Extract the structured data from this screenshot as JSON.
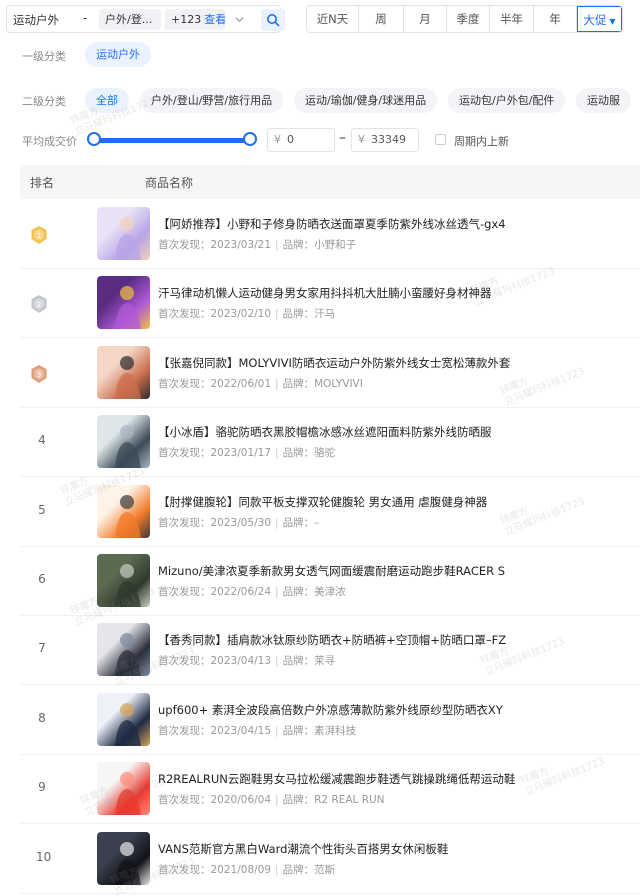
{
  "category": {
    "main": "运动户外",
    "separator": "-",
    "sub_tag": "户外/登...",
    "more_count": "+123",
    "more_link": "查看"
  },
  "periods": [
    "近N天",
    "周",
    "月",
    "季度",
    "半年",
    "年"
  ],
  "active_period": "大促",
  "filters": {
    "level1_label": "一级分类",
    "level1_value": "运动户外",
    "level2_label": "二级分类",
    "level2_items": [
      "全部",
      "户外/登山/野营/旅行用品",
      "运动/瑜伽/健身/球迷用品",
      "运动包/户外包/配件",
      "运动服"
    ],
    "price_label": "平均成交价",
    "price_currency": "¥",
    "price_min": "0",
    "price_max": "33349",
    "price_dash": "–",
    "new_label": "周期内上新"
  },
  "table": {
    "col_rank": "排名",
    "col_name": "商品名称",
    "first_seen_label": "首次发现：",
    "brand_label": "品牌：",
    "rows": [
      {
        "rank": "1",
        "title": "【阿娇推荐】小野和子修身防晒衣送面罩夏季防紫外线冰丝透气-gx4",
        "date": "2023/03/21",
        "brand": "小野和子"
      },
      {
        "rank": "2",
        "title": "汗马律动机懒人运动健身男女家用抖抖机大肚腩小蛮腰好身材神器",
        "date": "2023/02/10",
        "brand": "汗马"
      },
      {
        "rank": "3",
        "title": "【张嘉倪同款】MOLYVIVI防晒衣运动户外防紫外线女士宽松薄款外套",
        "date": "2022/06/01",
        "brand": "MOLYVIVI"
      },
      {
        "rank": "4",
        "title": "【小冰盾】骆驼防晒衣黑胶帽檐冰感冰丝遮阳面料防紫外线防晒服",
        "date": "2023/01/17",
        "brand": "骆驼"
      },
      {
        "rank": "5",
        "title": "【肘撑健腹轮】同款平板支撑双轮健腹轮 男女通用 虐腹健身神器",
        "date": "2023/05/30",
        "brand": "–"
      },
      {
        "rank": "6",
        "title": "Mizuno/美津浓夏季新款男女透气网面缓震耐磨运动跑步鞋RACER S",
        "date": "2022/06/24",
        "brand": "美津浓"
      },
      {
        "rank": "7",
        "title": "【香秀同款】插肩款冰钛原纱防晒衣+防晒裤+空顶帽+防晒口罩–FZ",
        "date": "2023/04/13",
        "brand": "茉寻"
      },
      {
        "rank": "8",
        "title": "upf600+ 素湃全波段高倍数户外凉感薄款防紫外线原纱型防晒衣XY",
        "date": "2023/04/15",
        "brand": "素湃科技"
      },
      {
        "rank": "9",
        "title": "R2REALRUN云跑鞋男女马拉松缓减震跑步鞋透气跳操跳绳低帮运动鞋",
        "date": "2020/06/04",
        "brand": "R2 REAL RUN"
      },
      {
        "rank": "10",
        "title": "VANS范斯官方黑白Ward潮流个性街头百搭男女休闲板鞋",
        "date": "2021/08/09",
        "brand": "范斯"
      }
    ]
  },
  "watermark": [
    "锌魔方",
    "立马耀玛科技1723"
  ],
  "colors": {
    "accent": "#1f6ff5",
    "gold": "#f2b62f",
    "silver": "#b8bcc4",
    "bronze": "#d98c62"
  }
}
